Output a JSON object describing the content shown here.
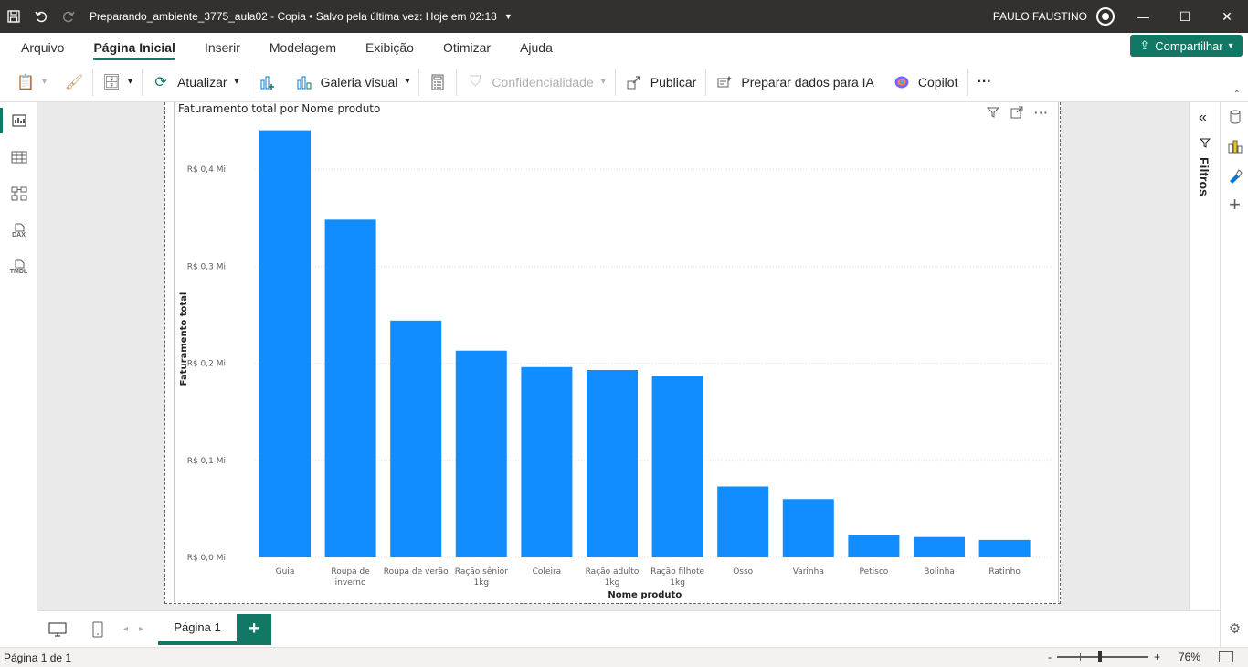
{
  "titlebar": {
    "doc_title": "Preparando_ambiente_3775_aula02 - Copia • Salvo pela última vez: Hoje em 02:18",
    "user": "PAULO FAUSTINO",
    "icons": [
      "save-icon",
      "undo-icon",
      "redo-icon",
      "user-avatar-icon"
    ]
  },
  "menu": {
    "items": [
      "Arquivo",
      "Página Inicial",
      "Inserir",
      "Modelagem",
      "Exibição",
      "Otimizar",
      "Ajuda"
    ],
    "active": "Página Inicial",
    "share_label": "Compartilhar"
  },
  "ribbon": {
    "refresh": "Atualizar",
    "visual_gallery": "Galeria visual",
    "sensitivity": "Confidencialidade",
    "publish": "Publicar",
    "prepare_ai": "Preparar dados para IA",
    "copilot": "Copilot",
    "more": "···"
  },
  "leftbar": {
    "dax_label": "DAX",
    "tmdl_label": "TMDL"
  },
  "filters": {
    "label": "Filtros"
  },
  "pages": {
    "tab": "Página 1",
    "add": "+"
  },
  "status": {
    "page_info": "Página 1 de 1",
    "zoom": "76%",
    "minus": "-",
    "plus": "+"
  },
  "chart_data": {
    "type": "bar",
    "title": "Faturamento total por Nome produto",
    "xlabel": "Nome produto",
    "ylabel": "Faturamento total",
    "categories": [
      [
        "Guia"
      ],
      [
        "Roupa de",
        "inverno"
      ],
      [
        "Roupa de verão"
      ],
      [
        "Ração sênior",
        "1kg"
      ],
      [
        "Coleira"
      ],
      [
        "Ração adulto",
        "1kg"
      ],
      [
        "Ração filhote",
        "1kg"
      ],
      [
        "Osso"
      ],
      [
        "Varinha"
      ],
      [
        "Petisco"
      ],
      [
        "Bolinha"
      ],
      [
        "Ratinho"
      ]
    ],
    "values": [
      0.44,
      0.348,
      0.244,
      0.213,
      0.196,
      0.193,
      0.187,
      0.073,
      0.06,
      0.023,
      0.021,
      0.018
    ],
    "yticks": [
      {
        "v": 0.0,
        "label": "R$ 0,0 Mi"
      },
      {
        "v": 0.1,
        "label": "R$ 0,1 Mi"
      },
      {
        "v": 0.2,
        "label": "R$ 0,2 Mi"
      },
      {
        "v": 0.3,
        "label": "R$ 0,3 Mi"
      },
      {
        "v": 0.4,
        "label": "R$ 0,4 Mi"
      }
    ],
    "ylim": [
      0,
      0.45
    ],
    "grid": true,
    "bar_color": "#118DFF"
  },
  "colors": {
    "accent": "#117865",
    "bar": "#118DFF"
  }
}
